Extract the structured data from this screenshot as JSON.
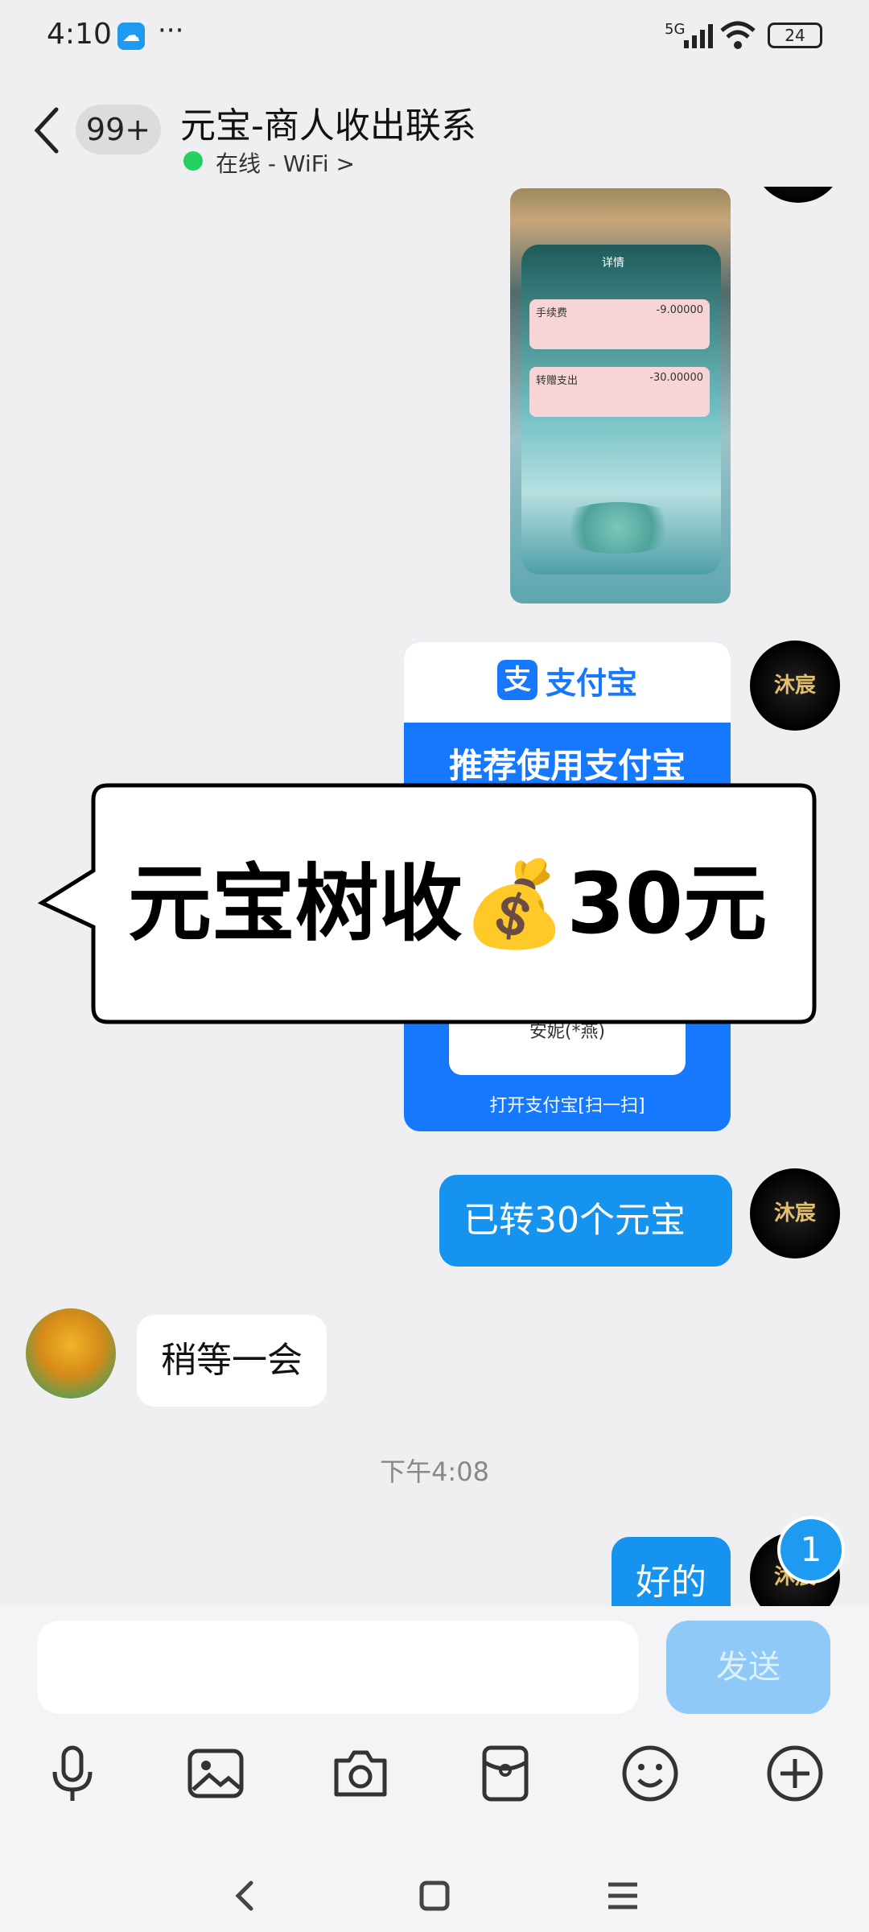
{
  "status_bar": {
    "time": "4:10",
    "network": "5G",
    "battery": "24",
    "more": "···"
  },
  "header": {
    "unread_count": "99+",
    "title": "元宝-商人收出联系",
    "presence": "在线 - WiFi",
    "presence_chevron": ">"
  },
  "messages": {
    "screenshot_detail": {
      "screen_title": "详情",
      "row1_title": "手续费",
      "row1_amount": "-9.00000",
      "row2_title": "转赠支出",
      "row2_amount": "-30.00000"
    },
    "alipay_card": {
      "logo_char": "支",
      "brand": "支付宝",
      "recommend": "推荐使用支付宝",
      "payee": "安妮(*燕)",
      "scan_hint": "打开支付宝[扫一扫]"
    },
    "sent_transfer": "已转30个元宝",
    "received_wait": "稍等一会",
    "timestamp": "下午4:08",
    "sent_ok": "好的",
    "new_badge": "1"
  },
  "overlay": {
    "text": "元宝树收💰30元"
  },
  "input_bar": {
    "placeholder": "",
    "send_label": "发送"
  },
  "colors": {
    "accent": "#1593ef",
    "send_disabled": "#8ec9f7",
    "online": "#23d160",
    "alipay_blue": "#1677ff"
  }
}
